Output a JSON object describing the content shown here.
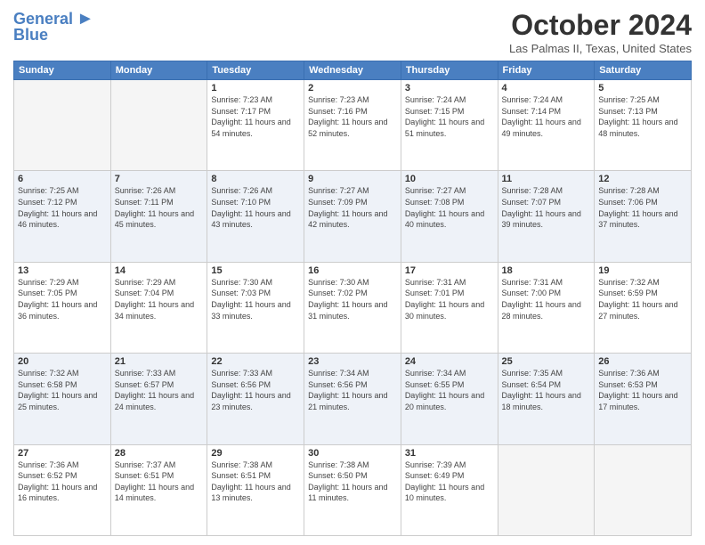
{
  "header": {
    "logo_line1": "General",
    "logo_line2": "Blue",
    "month_title": "October 2024",
    "location": "Las Palmas II, Texas, United States"
  },
  "weekdays": [
    "Sunday",
    "Monday",
    "Tuesday",
    "Wednesday",
    "Thursday",
    "Friday",
    "Saturday"
  ],
  "weeks": [
    [
      {
        "day": "",
        "sunrise": "",
        "sunset": "",
        "daylight": ""
      },
      {
        "day": "",
        "sunrise": "",
        "sunset": "",
        "daylight": ""
      },
      {
        "day": "1",
        "sunrise": "Sunrise: 7:23 AM",
        "sunset": "Sunset: 7:17 PM",
        "daylight": "Daylight: 11 hours and 54 minutes."
      },
      {
        "day": "2",
        "sunrise": "Sunrise: 7:23 AM",
        "sunset": "Sunset: 7:16 PM",
        "daylight": "Daylight: 11 hours and 52 minutes."
      },
      {
        "day": "3",
        "sunrise": "Sunrise: 7:24 AM",
        "sunset": "Sunset: 7:15 PM",
        "daylight": "Daylight: 11 hours and 51 minutes."
      },
      {
        "day": "4",
        "sunrise": "Sunrise: 7:24 AM",
        "sunset": "Sunset: 7:14 PM",
        "daylight": "Daylight: 11 hours and 49 minutes."
      },
      {
        "day": "5",
        "sunrise": "Sunrise: 7:25 AM",
        "sunset": "Sunset: 7:13 PM",
        "daylight": "Daylight: 11 hours and 48 minutes."
      }
    ],
    [
      {
        "day": "6",
        "sunrise": "Sunrise: 7:25 AM",
        "sunset": "Sunset: 7:12 PM",
        "daylight": "Daylight: 11 hours and 46 minutes."
      },
      {
        "day": "7",
        "sunrise": "Sunrise: 7:26 AM",
        "sunset": "Sunset: 7:11 PM",
        "daylight": "Daylight: 11 hours and 45 minutes."
      },
      {
        "day": "8",
        "sunrise": "Sunrise: 7:26 AM",
        "sunset": "Sunset: 7:10 PM",
        "daylight": "Daylight: 11 hours and 43 minutes."
      },
      {
        "day": "9",
        "sunrise": "Sunrise: 7:27 AM",
        "sunset": "Sunset: 7:09 PM",
        "daylight": "Daylight: 11 hours and 42 minutes."
      },
      {
        "day": "10",
        "sunrise": "Sunrise: 7:27 AM",
        "sunset": "Sunset: 7:08 PM",
        "daylight": "Daylight: 11 hours and 40 minutes."
      },
      {
        "day": "11",
        "sunrise": "Sunrise: 7:28 AM",
        "sunset": "Sunset: 7:07 PM",
        "daylight": "Daylight: 11 hours and 39 minutes."
      },
      {
        "day": "12",
        "sunrise": "Sunrise: 7:28 AM",
        "sunset": "Sunset: 7:06 PM",
        "daylight": "Daylight: 11 hours and 37 minutes."
      }
    ],
    [
      {
        "day": "13",
        "sunrise": "Sunrise: 7:29 AM",
        "sunset": "Sunset: 7:05 PM",
        "daylight": "Daylight: 11 hours and 36 minutes."
      },
      {
        "day": "14",
        "sunrise": "Sunrise: 7:29 AM",
        "sunset": "Sunset: 7:04 PM",
        "daylight": "Daylight: 11 hours and 34 minutes."
      },
      {
        "day": "15",
        "sunrise": "Sunrise: 7:30 AM",
        "sunset": "Sunset: 7:03 PM",
        "daylight": "Daylight: 11 hours and 33 minutes."
      },
      {
        "day": "16",
        "sunrise": "Sunrise: 7:30 AM",
        "sunset": "Sunset: 7:02 PM",
        "daylight": "Daylight: 11 hours and 31 minutes."
      },
      {
        "day": "17",
        "sunrise": "Sunrise: 7:31 AM",
        "sunset": "Sunset: 7:01 PM",
        "daylight": "Daylight: 11 hours and 30 minutes."
      },
      {
        "day": "18",
        "sunrise": "Sunrise: 7:31 AM",
        "sunset": "Sunset: 7:00 PM",
        "daylight": "Daylight: 11 hours and 28 minutes."
      },
      {
        "day": "19",
        "sunrise": "Sunrise: 7:32 AM",
        "sunset": "Sunset: 6:59 PM",
        "daylight": "Daylight: 11 hours and 27 minutes."
      }
    ],
    [
      {
        "day": "20",
        "sunrise": "Sunrise: 7:32 AM",
        "sunset": "Sunset: 6:58 PM",
        "daylight": "Daylight: 11 hours and 25 minutes."
      },
      {
        "day": "21",
        "sunrise": "Sunrise: 7:33 AM",
        "sunset": "Sunset: 6:57 PM",
        "daylight": "Daylight: 11 hours and 24 minutes."
      },
      {
        "day": "22",
        "sunrise": "Sunrise: 7:33 AM",
        "sunset": "Sunset: 6:56 PM",
        "daylight": "Daylight: 11 hours and 23 minutes."
      },
      {
        "day": "23",
        "sunrise": "Sunrise: 7:34 AM",
        "sunset": "Sunset: 6:56 PM",
        "daylight": "Daylight: 11 hours and 21 minutes."
      },
      {
        "day": "24",
        "sunrise": "Sunrise: 7:34 AM",
        "sunset": "Sunset: 6:55 PM",
        "daylight": "Daylight: 11 hours and 20 minutes."
      },
      {
        "day": "25",
        "sunrise": "Sunrise: 7:35 AM",
        "sunset": "Sunset: 6:54 PM",
        "daylight": "Daylight: 11 hours and 18 minutes."
      },
      {
        "day": "26",
        "sunrise": "Sunrise: 7:36 AM",
        "sunset": "Sunset: 6:53 PM",
        "daylight": "Daylight: 11 hours and 17 minutes."
      }
    ],
    [
      {
        "day": "27",
        "sunrise": "Sunrise: 7:36 AM",
        "sunset": "Sunset: 6:52 PM",
        "daylight": "Daylight: 11 hours and 16 minutes."
      },
      {
        "day": "28",
        "sunrise": "Sunrise: 7:37 AM",
        "sunset": "Sunset: 6:51 PM",
        "daylight": "Daylight: 11 hours and 14 minutes."
      },
      {
        "day": "29",
        "sunrise": "Sunrise: 7:38 AM",
        "sunset": "Sunset: 6:51 PM",
        "daylight": "Daylight: 11 hours and 13 minutes."
      },
      {
        "day": "30",
        "sunrise": "Sunrise: 7:38 AM",
        "sunset": "Sunset: 6:50 PM",
        "daylight": "Daylight: 11 hours and 11 minutes."
      },
      {
        "day": "31",
        "sunrise": "Sunrise: 7:39 AM",
        "sunset": "Sunset: 6:49 PM",
        "daylight": "Daylight: 11 hours and 10 minutes."
      },
      {
        "day": "",
        "sunrise": "",
        "sunset": "",
        "daylight": ""
      },
      {
        "day": "",
        "sunrise": "",
        "sunset": "",
        "daylight": ""
      }
    ]
  ]
}
